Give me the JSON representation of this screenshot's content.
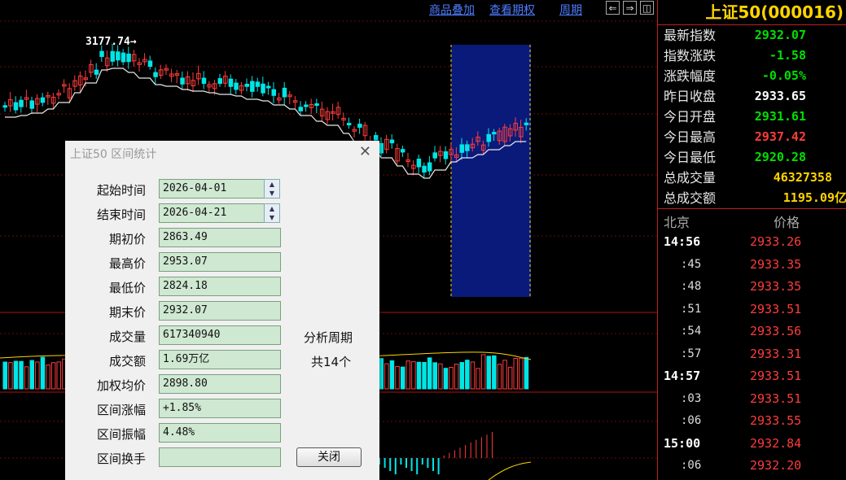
{
  "toolbar": {
    "overlay_label": "商品叠加",
    "rights_label": "查看期权",
    "period_label": "周期",
    "prev_glyph": "⇐",
    "next_glyph": "⇒",
    "layout_glyph": "◫"
  },
  "chart": {
    "peak_label": "3177.74",
    "colors": {
      "up": "#ff3c3c",
      "down": "#00e6e6",
      "ma": "#e8e8e8",
      "highlight": "#0a1a7a",
      "grid": "#8a1010"
    }
  },
  "quote": {
    "title": "上证50(000016)",
    "rows": [
      {
        "label": "最新指数",
        "value": "2932.07",
        "color": "#00e000"
      },
      {
        "label": "指数涨跌",
        "value": "-1.58",
        "color": "#00e000"
      },
      {
        "label": "涨跌幅度",
        "value": "-0.05%",
        "color": "#00e000"
      },
      {
        "label": "昨日收盘",
        "value": "2933.65",
        "color": "#ffffff"
      },
      {
        "label": "今日开盘",
        "value": "2931.61",
        "color": "#00e000"
      },
      {
        "label": "今日最高",
        "value": "2937.42",
        "color": "#ff3c3c"
      },
      {
        "label": "今日最低",
        "value": "2920.28",
        "color": "#00e000"
      },
      {
        "label": "总成交量",
        "value": "46327358",
        "color": "#ffd400"
      },
      {
        "label": "总成交额",
        "value": "1195.09亿",
        "color": "#ffd400"
      }
    ]
  },
  "ticks": {
    "header_time": "北京",
    "header_price": "价格",
    "rows": [
      {
        "time": "14:56",
        "price": "2933.26",
        "big": true
      },
      {
        "time": ":45",
        "price": "2933.35",
        "big": false
      },
      {
        "time": ":48",
        "price": "2933.35",
        "big": false
      },
      {
        "time": ":51",
        "price": "2933.51",
        "big": false
      },
      {
        "time": ":54",
        "price": "2933.56",
        "big": false
      },
      {
        "time": ":57",
        "price": "2933.31",
        "big": false
      },
      {
        "time": "14:57",
        "price": "2933.51",
        "big": true
      },
      {
        "time": ":03",
        "price": "2933.51",
        "big": false
      },
      {
        "time": ":06",
        "price": "2933.55",
        "big": false
      },
      {
        "time": "15:00",
        "price": "2932.84",
        "big": true
      },
      {
        "time": ":06",
        "price": "2932.20",
        "big": false
      }
    ]
  },
  "dialog": {
    "title": "上证50 区间统计",
    "close_glyph": "✕",
    "fields": [
      {
        "label": "起始时间",
        "value": "2026-04-01",
        "spinner": true
      },
      {
        "label": "结束时间",
        "value": "2026-04-21",
        "spinner": true
      },
      {
        "label": "期初价",
        "value": "2863.49"
      },
      {
        "label": "最高价",
        "value": "2953.07"
      },
      {
        "label": "最低价",
        "value": "2824.18"
      },
      {
        "label": "期末价",
        "value": "2932.07"
      },
      {
        "label": "成交量",
        "value": "617340940"
      },
      {
        "label": "成交额",
        "value": "1.69万亿"
      },
      {
        "label": "加权均价",
        "value": "2898.80"
      },
      {
        "label": "区间涨幅",
        "value": "+1.85%"
      },
      {
        "label": "区间振幅",
        "value": "4.48%"
      },
      {
        "label": "区间换手",
        "value": ""
      }
    ],
    "period_label": "分析周期",
    "period_count": "共14个",
    "close_button": "关闭"
  }
}
